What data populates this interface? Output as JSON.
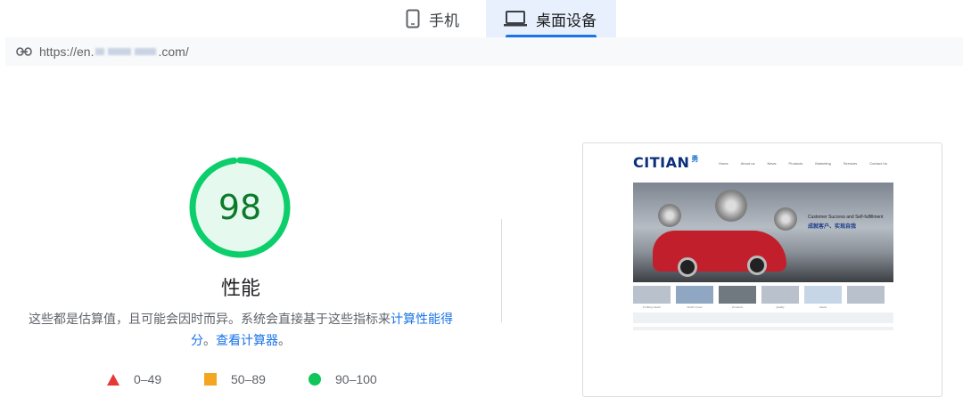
{
  "tabs": {
    "mobile": {
      "label": "手机",
      "icon": "phone-icon"
    },
    "desktop": {
      "label": "桌面设备",
      "icon": "laptop-icon",
      "selected": true
    }
  },
  "url_bar": {
    "icon": "link-icon",
    "prefix": "https://en.",
    "suffix": ".com/"
  },
  "score": {
    "value": "98",
    "fraction": 0.98,
    "color": "#0cce6b",
    "metric": "性能"
  },
  "description": {
    "text": "这些都是估算值，且可能会因时而异。系统会直接基于这些指标来",
    "link1": "计算性能得分",
    "sep": "。",
    "link2": "查看计算器",
    "end": "。"
  },
  "legend": [
    {
      "shape": "triangle",
      "color": "#e53935",
      "label": "0–49"
    },
    {
      "shape": "square",
      "color": "#f4a621",
      "label": "50–89"
    },
    {
      "shape": "circle",
      "color": "#10c55a",
      "label": "90–100"
    }
  ],
  "thumbnail": {
    "logo": "CITIAN",
    "logo_cn": "勇",
    "nav": [
      "Home",
      "About us",
      "News",
      "Products",
      "Marketing",
      "Services",
      "Contact Us"
    ],
    "tagline": "Customer Success and Self-fulfillment",
    "tagline_cn": "成就客户、实现自我",
    "tiles": [
      "Pr-filling Clutch",
      "Clutch Cover",
      "Products",
      "Quality",
      "Faults",
      ""
    ]
  }
}
